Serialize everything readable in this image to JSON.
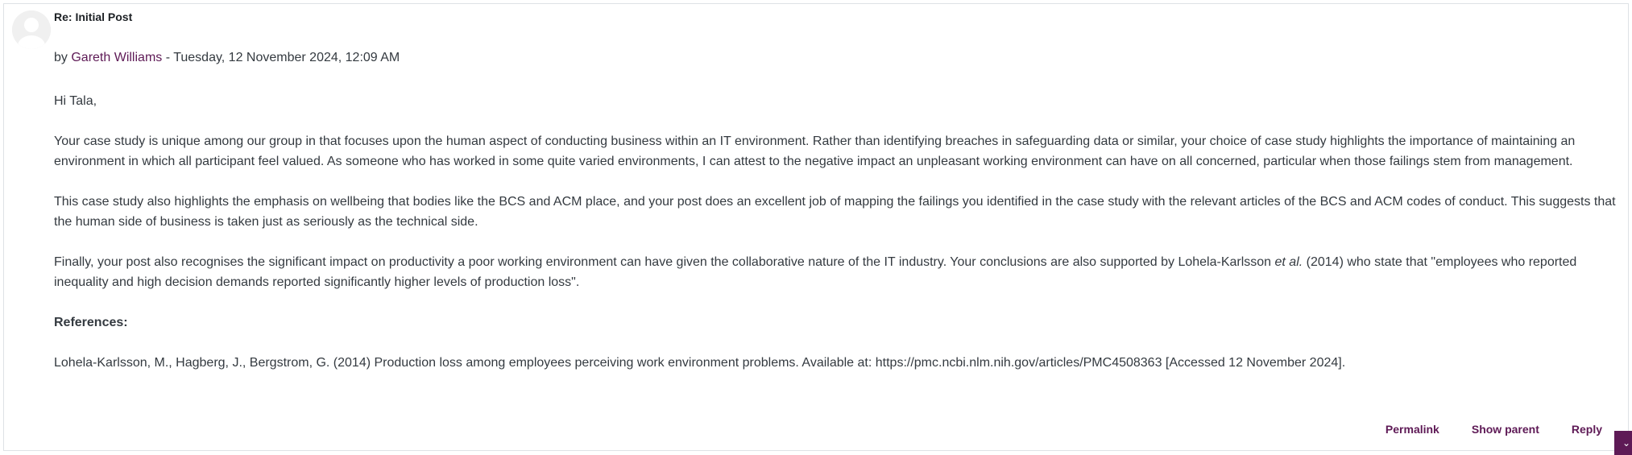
{
  "post": {
    "subject": "Re: Initial Post",
    "byline_prefix": "by",
    "author": "Gareth Williams",
    "byline_separator": " - ",
    "date": "Tuesday, 12 November 2024, 12:09 AM",
    "greeting": "Hi Tala,",
    "paragraph1": "Your case study is unique among our group in that focuses upon the human aspect of conducting business within an IT environment. Rather than identifying breaches in safeguarding data or similar, your choice of case study highlights the importance of maintaining an environment in which all participant feel valued. As someone who has worked in some quite varied environments, I can attest to the negative impact an unpleasant working environment can have on all concerned, particular when those failings stem from management.",
    "paragraph2": "This case study also highlights the emphasis on wellbeing that bodies like the BCS and ACM place, and your post does an excellent job of mapping the failings you identified in the case study with the relevant articles of the BCS and ACM codes of conduct. This suggests that the human side of business is taken just as seriously as the technical side.",
    "paragraph3_before": "Finally, your post also recognises the significant impact on productivity a poor working environment can have given the collaborative nature of the IT industry. Your conclusions are also supported by Lohela-Karlsson ",
    "paragraph3_italic": "et al.",
    "paragraph3_after": " (2014) who state that \"employees who reported inequality and high decision demands reported significantly higher levels of production loss\".",
    "references_heading": "References:",
    "reference1": "Lohela-Karlsson, M., Hagberg, J., Bergstrom, G. (2014) Production loss among employees perceiving work environment problems. Available at: https://pmc.ncbi.nlm.nih.gov/articles/PMC4508363 [Accessed 12 November 2024]."
  },
  "actions": {
    "permalink": "Permalink",
    "show_parent": "Show parent",
    "reply": "Reply"
  },
  "corner_tab": {
    "label": "⌄"
  },
  "colors": {
    "link": "#5e1a56",
    "text": "#343a40",
    "border": "#dee2e6",
    "avatar_bg": "#f0f0f0"
  },
  "icons": {
    "avatar": "default-user-avatar-icon"
  }
}
